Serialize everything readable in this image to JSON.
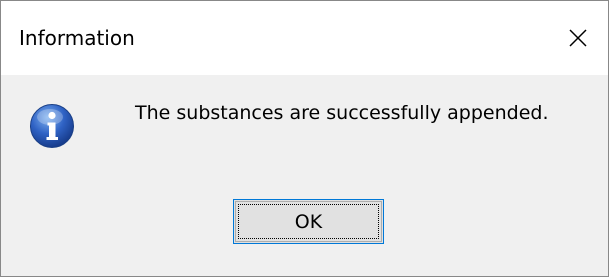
{
  "window": {
    "title": "Information",
    "close_icon": "close-icon",
    "background": "#f0f0f0",
    "titlebar_background": "#ffffff"
  },
  "dialog": {
    "icon": "info-icon",
    "icon_color": "#2b5db8",
    "message": "The substances are successfully appended.",
    "ok_label": "OK",
    "ok_border_color": "#0078d7"
  }
}
